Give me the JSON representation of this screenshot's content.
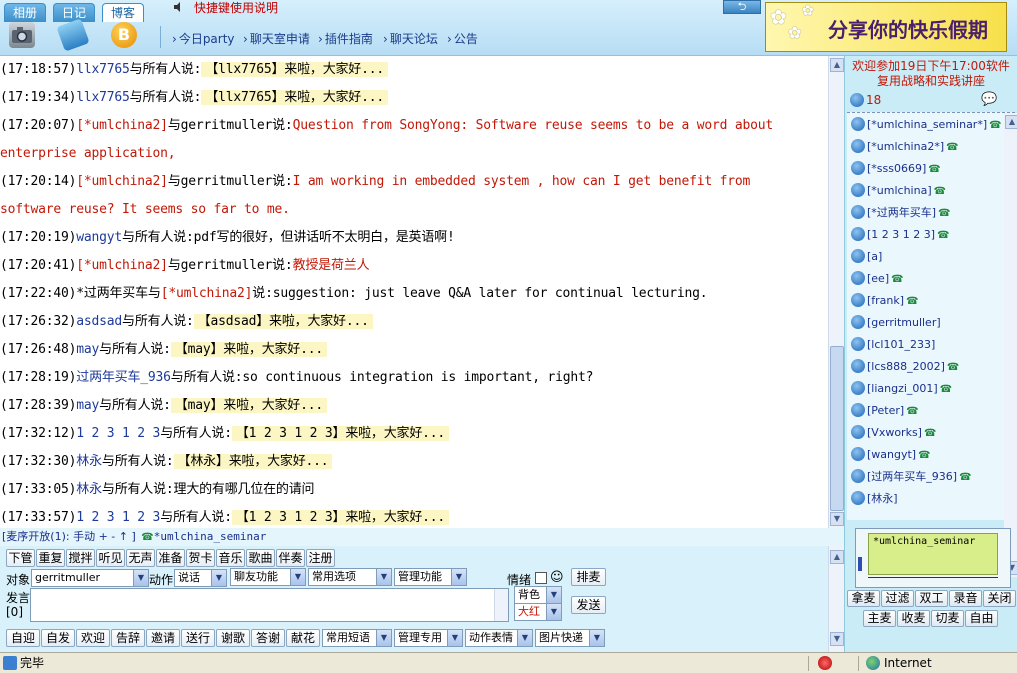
{
  "header": {
    "tabs": [
      "相册",
      "日记",
      "博客"
    ],
    "shortcut_text": "快捷键使用说明",
    "nav_links": [
      "今日party",
      "聊天室申请",
      "插件指南",
      "聊天论坛",
      "公告"
    ],
    "banner_text": "分享你的快乐假期"
  },
  "chat": {
    "messages": [
      {
        "parts": [
          {
            "t": "(17:18:57)"
          },
          {
            "t": "llx7765",
            "c": "blue"
          },
          {
            "t": "与所有人说:"
          },
          {
            "t": "【llx7765】来啦，大家好...",
            "c": "hl"
          }
        ]
      },
      {
        "parts": [
          {
            "t": "(17:19:34)"
          },
          {
            "t": "llx7765",
            "c": "blue"
          },
          {
            "t": "与所有人说:"
          },
          {
            "t": "【llx7765】来啦，大家好...",
            "c": "hl"
          }
        ]
      },
      {
        "parts": [
          {
            "t": "(17:20:07)"
          },
          {
            "t": "[*umlchina2]",
            "c": "red"
          },
          {
            "t": "与gerritmuller说:"
          },
          {
            "t": "Question from SongYong: Software reuse seems to be a word about",
            "c": "red"
          }
        ]
      },
      {
        "parts": [
          {
            "t": "enterprise application,",
            "c": "red"
          }
        ]
      },
      {
        "parts": [
          {
            "t": "(17:20:14)"
          },
          {
            "t": "[*umlchina2]",
            "c": "red"
          },
          {
            "t": "与gerritmuller说:"
          },
          {
            "t": "I am working in embedded system , how can I get benefit from",
            "c": "red"
          }
        ]
      },
      {
        "parts": [
          {
            "t": "software reuse? It seems so far to me.",
            "c": "red"
          }
        ]
      },
      {
        "parts": [
          {
            "t": "(17:20:19)"
          },
          {
            "t": "wangyt",
            "c": "blue"
          },
          {
            "t": "与所有人说:pdf写的很好，但讲话听不太明白，是英语啊!"
          }
        ]
      },
      {
        "parts": [
          {
            "t": "(17:20:41)"
          },
          {
            "t": "[*umlchina2]",
            "c": "red"
          },
          {
            "t": "与gerritmuller说:"
          },
          {
            "t": "教授是荷兰人",
            "c": "red"
          }
        ]
      },
      {
        "parts": [
          {
            "t": "(17:22:40)"
          },
          {
            "t": "*过两年买车"
          },
          {
            "t": "与"
          },
          {
            "t": "[*umlchina2]",
            "c": "red"
          },
          {
            "t": "说:suggestion: just leave Q&A later for continual lecturing."
          }
        ]
      },
      {
        "parts": [
          {
            "t": "(17:26:32)"
          },
          {
            "t": "asdsad",
            "c": "blue"
          },
          {
            "t": "与所有人说:"
          },
          {
            "t": "【asdsad】来啦，大家好...",
            "c": "hl"
          }
        ]
      },
      {
        "parts": [
          {
            "t": "(17:26:48)"
          },
          {
            "t": "may",
            "c": "blue"
          },
          {
            "t": "与所有人说:"
          },
          {
            "t": "【may】来啦，大家好...",
            "c": "hl"
          }
        ]
      },
      {
        "parts": [
          {
            "t": "(17:28:19)"
          },
          {
            "t": "过两年买车_936",
            "c": "blue"
          },
          {
            "t": "与所有人说:so continuous integration is important, right?"
          }
        ]
      },
      {
        "parts": [
          {
            "t": "(17:28:39)"
          },
          {
            "t": "may",
            "c": "blue"
          },
          {
            "t": "与所有人说:"
          },
          {
            "t": "【may】来啦，大家好...",
            "c": "hl"
          }
        ]
      },
      {
        "parts": [
          {
            "t": "(17:32:12)"
          },
          {
            "t": "1 2 3 1 2 3",
            "c": "blue"
          },
          {
            "t": "与所有人说:"
          },
          {
            "t": "【1 2 3 1 2 3】来啦，大家好...",
            "c": "hl"
          }
        ]
      },
      {
        "parts": [
          {
            "t": "(17:32:30)"
          },
          {
            "t": "林永",
            "c": "blue"
          },
          {
            "t": "与所有人说:"
          },
          {
            "t": "【林永】来啦，大家好...",
            "c": "hl"
          }
        ]
      },
      {
        "parts": [
          {
            "t": "(17:33:05)"
          },
          {
            "t": "林永",
            "c": "blue"
          },
          {
            "t": "与所有人说:理大的有哪几位在的请问"
          }
        ]
      },
      {
        "parts": [
          {
            "t": "(17:33:57)"
          },
          {
            "t": "1 2 3 1 2 3",
            "c": "blue"
          },
          {
            "t": "与所有人说:"
          },
          {
            "t": "【1 2 3 1 2 3】来啦，大家好...",
            "c": "hl"
          }
        ]
      }
    ]
  },
  "right_panel": {
    "welcome": "欢迎参加19日下午17:00软件复用战略和实践讲座",
    "online_count": "18",
    "users": [
      {
        "name": "[*umlchina_seminar*]",
        "phone": true
      },
      {
        "name": "[*umlchina2*]",
        "phone": true
      },
      {
        "name": "[*sss0669]",
        "phone": true
      },
      {
        "name": "[*umlchina]",
        "phone": true
      },
      {
        "name": "[*过两年买车]",
        "phone": true
      },
      {
        "name": "[1 2 3 1 2 3]",
        "phone": true
      },
      {
        "name": "[a]",
        "phone": false
      },
      {
        "name": "[ee]",
        "phone": true
      },
      {
        "name": "[frank]",
        "phone": true
      },
      {
        "name": "[gerritmuller]",
        "phone": false
      },
      {
        "name": "[lcl101_233]",
        "phone": false
      },
      {
        "name": "[lcs888_2002]",
        "phone": true
      },
      {
        "name": "[liangzi_001]",
        "phone": true
      },
      {
        "name": "[Peter]",
        "phone": true
      },
      {
        "name": "[Vxworks]",
        "phone": true
      },
      {
        "name": "[wangyt]",
        "phone": true
      },
      {
        "name": "[过两年买车_936]",
        "phone": true
      },
      {
        "name": "[林永]",
        "phone": false
      }
    ],
    "mic_user": "*umlchina_seminar",
    "buttons_row1": [
      "拿麦",
      "过滤",
      "双工",
      "录音",
      "关闭"
    ],
    "buttons_row2": [
      "主麦",
      "收麦",
      "切麦",
      "自由"
    ]
  },
  "controls": {
    "mic_status_prefix": "[麦序开放(1): 手动 + - ↑ ]",
    "mic_status_user": "*umlchina_seminar",
    "row1_buttons": [
      "下管",
      "重复",
      "搅拌",
      "听见",
      "无声",
      "准备",
      "贺卡",
      "音乐",
      "歌曲",
      "伴奏",
      "注册"
    ],
    "target_label": "对象",
    "target_value": "gerritmuller",
    "action_label": "动作",
    "action_value": "说话",
    "dropdowns_row2": [
      "聊友功能",
      "常用选项",
      "管理功能"
    ],
    "mood_label": "情绪",
    "sort_button": "排麦",
    "speak_label": "发言",
    "speak_count": "[0]",
    "bgcolor_value": "背色",
    "fontsize_value": "大红",
    "send_button": "发送",
    "row3_buttons": [
      "自迎",
      "自发",
      "欢迎",
      "告辞",
      "邀请",
      "送行",
      "谢歌",
      "答谢",
      "献花"
    ],
    "row3_dropdowns": [
      "常用短语",
      "管理专用",
      "动作表情",
      "图片快递"
    ]
  },
  "statusbar": {
    "status": "完毕",
    "zone": "Internet"
  },
  "colors": {
    "system_red": "#c21807",
    "user_blue": "#1e3a9a",
    "highlight": "#fbf6c4",
    "panel_bg": "#c9ecf7"
  }
}
